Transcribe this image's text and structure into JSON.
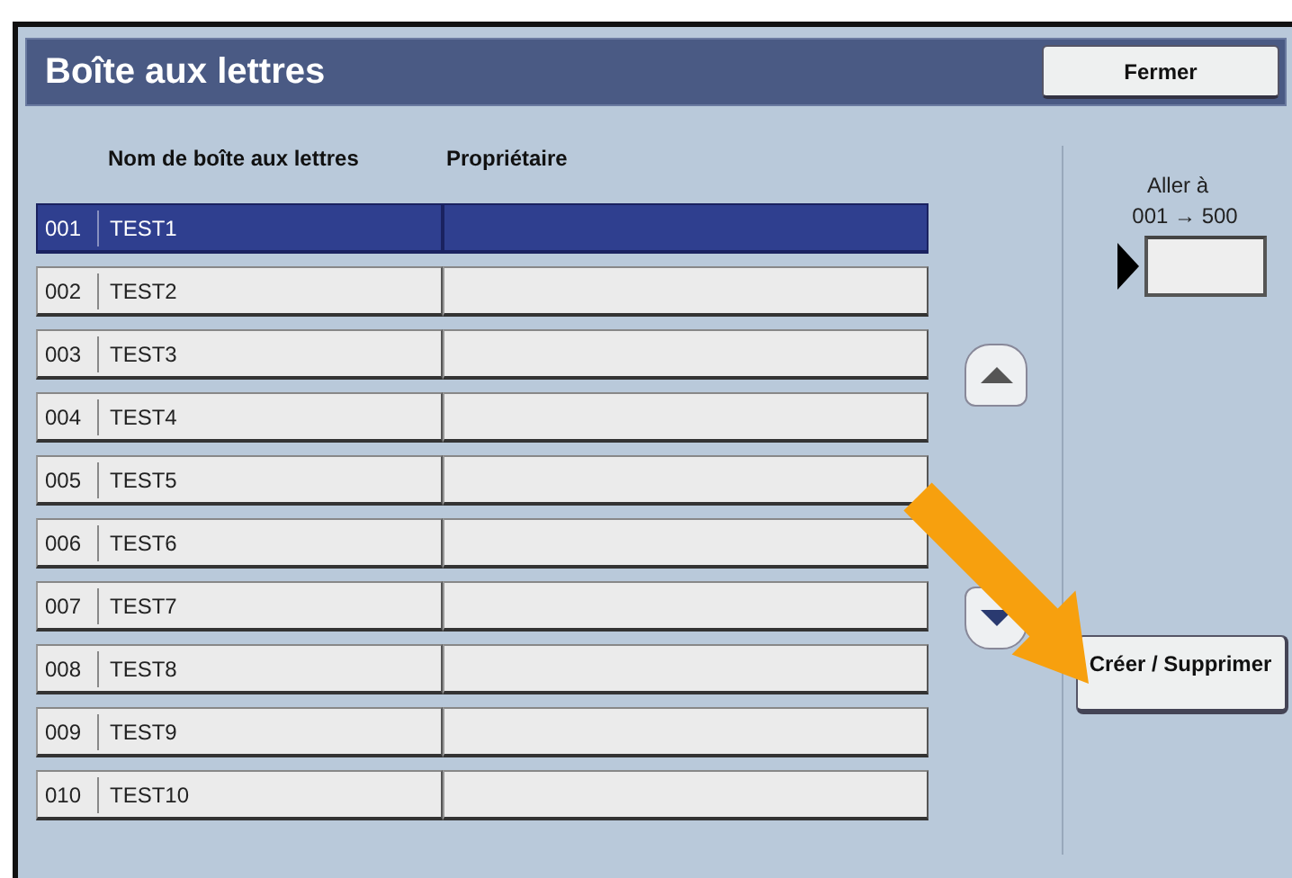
{
  "title": "Boîte aux lettres",
  "close_button": "Fermer",
  "columns": [
    "Nom de boîte aux lettres",
    "Propriétaire"
  ],
  "rows": [
    {
      "number": "001",
      "name": "TEST1",
      "selected": true
    },
    {
      "number": "002",
      "name": "TEST2",
      "selected": false
    },
    {
      "number": "003",
      "name": "TEST3",
      "selected": false
    },
    {
      "number": "004",
      "name": "TEST4",
      "selected": false
    },
    {
      "number": "005",
      "name": "TEST5",
      "selected": false
    },
    {
      "number": "006",
      "name": "TEST6",
      "selected": false
    },
    {
      "number": "007",
      "name": "TEST7",
      "selected": false
    },
    {
      "number": "008",
      "name": "TEST8",
      "selected": false
    },
    {
      "number": "009",
      "name": "TEST9",
      "selected": false
    },
    {
      "number": "010",
      "name": "TEST10",
      "selected": false
    }
  ],
  "goto": {
    "label": "Aller à",
    "range": "001 → 500"
  },
  "create_button": "Créer / Supprimer"
}
